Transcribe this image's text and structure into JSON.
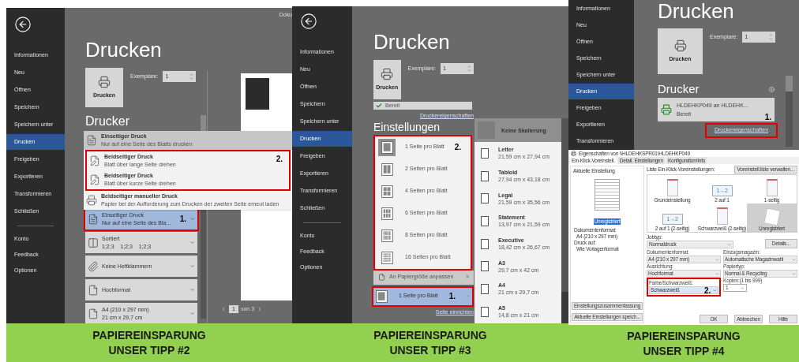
{
  "panels": [
    {
      "kind": "duplex",
      "back_button": true,
      "doc_title": "Doku",
      "sidebar": [
        {
          "label": "Informationen",
          "selected": false
        },
        {
          "label": "Neu",
          "selected": false
        },
        {
          "label": "Öffnen",
          "selected": false
        },
        {
          "label": "Speichern",
          "selected": false
        },
        {
          "label": "Speichern unter",
          "selected": false
        },
        {
          "label": "Drucken",
          "selected": true
        },
        {
          "label": "Freigeben",
          "selected": false
        },
        {
          "label": "Exportieren",
          "selected": false
        },
        {
          "label": "Transformieren",
          "selected": false
        },
        {
          "label": "Schließen",
          "selected": false
        }
      ],
      "sidebar_bottom": [
        "Konto",
        "Feedback",
        "Optionen"
      ],
      "title": "Drucken",
      "print_button": "Drucken",
      "copies_label": "Exemplare:",
      "copies": "1",
      "printer_heading": "Drucker",
      "menu": {
        "before": [
          {
            "title": "Einseitiger Druck",
            "subtitle": "Nur auf eine Seite des Blatts drucken",
            "selected": true
          }
        ],
        "framed": {
          "marker": "2.",
          "items": [
            {
              "title": "Beidseitiger Druck",
              "subtitle": "Blatt über lange Seite drehen",
              "selected": false
            },
            {
              "title": "Beidseitiger Druck",
              "subtitle": "Blatt über kurze Seite drehen",
              "selected": false
            }
          ]
        },
        "after": [
          {
            "title": "Beidseitiger manueller Druck",
            "subtitle": "Papier bei der Aufforderung zum Drucken der zweiten Seite erneut laden",
            "selected": false
          }
        ]
      },
      "settings": [
        {
          "title": "Einseitiger Druck",
          "subtitle": "Nur auf eine Seite des Bla...",
          "selected": true,
          "marker": "1."
        },
        {
          "title": "Sortiert",
          "subtitle": "1;2;3    1;2;3    1;2;3",
          "selected": false
        },
        {
          "title": "Keine Heftklammern",
          "selected": false
        },
        {
          "title": "Hochformat",
          "selected": false
        },
        {
          "title": "A4 (210 x 297 mm)",
          "subtitle": "21 cm x 29,7 cm",
          "selected": false
        }
      ],
      "pager": {
        "page": "1",
        "of": "von 3"
      },
      "footer": [
        "PAPIEREINSPARUNG",
        "UNSER TIPP #2"
      ]
    },
    {
      "kind": "pages",
      "back_button": true,
      "sidebar": [
        {
          "label": "Informationen",
          "selected": false
        },
        {
          "label": "Neu",
          "selected": false
        },
        {
          "label": "Öffnen",
          "selected": false
        },
        {
          "label": "Speichern",
          "selected": false
        },
        {
          "label": "Speichern unter",
          "selected": false
        },
        {
          "label": "Drucken",
          "selected": true
        },
        {
          "label": "Freigeben",
          "selected": false
        },
        {
          "label": "Exportieren",
          "selected": false
        },
        {
          "label": "Transformieren",
          "selected": false
        },
        {
          "label": "Schließen",
          "selected": false
        }
      ],
      "sidebar_bottom": [
        "Konto",
        "Feedback",
        "Optionen"
      ],
      "title": "Drucken",
      "print_button": "Drucken",
      "copies_label": "Exemplare:",
      "copies": "1",
      "printer_status": "Bereit",
      "properties_link": "Druckereigenschaften",
      "settings_heading": "Einstellungen",
      "pages": {
        "marker": "2.",
        "items": [
          {
            "label": "1 Seite pro Blatt",
            "selected": true
          },
          {
            "label": "2 Seiten pro Blatt",
            "selected": false
          },
          {
            "label": "4 Seiten pro Blatt",
            "selected": false
          },
          {
            "label": "6 Seiten pro Blatt",
            "selected": false
          },
          {
            "label": "8 Seiten pro Blatt",
            "selected": false
          },
          {
            "label": "16 Seiten pro Blatt",
            "selected": false
          }
        ]
      },
      "fit_item": "An Papiergröße anpassen",
      "fit_arrow": ">",
      "current": {
        "label": "1 Seite pro Blatt",
        "marker": "1."
      },
      "page_setup_link": "Seite einrichten",
      "scaling": [
        {
          "title": "Keine Skalierung",
          "selected": true
        },
        {
          "title": "Letter",
          "subtitle": "21,59 cm x 27,94 cm",
          "selected": false
        },
        {
          "title": "Tabloid",
          "subtitle": "27,94 cm x 43,18 cm",
          "selected": false
        },
        {
          "title": "Legal",
          "subtitle": "21,59 cm x 35,56 cm",
          "selected": false
        },
        {
          "title": "Statement",
          "subtitle": "13,97 cm x 21,59 cm",
          "selected": false
        },
        {
          "title": "Executive",
          "subtitle": "18,42 cm x 26,67 cm",
          "selected": false
        },
        {
          "title": "A3",
          "subtitle": "29,7 cm x 42 cm",
          "selected": false
        },
        {
          "title": "A4",
          "subtitle": "21 cm x 29,7 cm",
          "selected": false
        },
        {
          "title": "A5",
          "subtitle": "14,8 cm x 21 cm",
          "selected": false
        }
      ],
      "footer": [
        "PAPIEREINSPARUNG",
        "UNSER TIPP #3"
      ]
    },
    {
      "kind": "printer",
      "sidebar": [
        {
          "label": "Informationen",
          "selected": false
        },
        {
          "label": "Neu",
          "selected": false
        },
        {
          "label": "Öffnen",
          "selected": false
        },
        {
          "label": "Speichern",
          "selected": false
        },
        {
          "label": "Speichern unter",
          "selected": false
        },
        {
          "label": "Drucken",
          "selected": true
        },
        {
          "label": "Freigeben",
          "selected": false
        },
        {
          "label": "Exportieren",
          "selected": false
        },
        {
          "label": "Transformieren",
          "selected": false
        }
      ],
      "title": "Drucken",
      "print_button": "Drucken",
      "copies_label": "Exemplare:",
      "copies": "1",
      "printer_heading": "Drucker",
      "printer": {
        "name": "HLDEHKP049 an HLDEHK...",
        "status": "Bereit",
        "marker": "1."
      },
      "properties_link": "Druckereigenschaften",
      "dialog": {
        "title": "Eigenschaften von \\\\HLDEHKSPR01\\HLDEHKP049",
        "tabs": [
          {
            "label": "Ein-Klick-Voreinstell.",
            "selected": true
          },
          {
            "label": "Detail. Einstellungen",
            "selected": false
          },
          {
            "label": "Konfiguration/Info",
            "selected": false
          }
        ],
        "current_label": "Aktuelle Einstellung",
        "current_name": "Unregistriert",
        "summary": [
          "Dokumentenformat:",
          "A4 (210 x 297 mm)",
          "Druck auf:",
          "Wie Vorlagenformat"
        ],
        "left_buttons": [
          "Einstellungszusammenfassung",
          "Aktuelle Einstellungen speich..."
        ],
        "list_label": "Liste Ein-Klick-Voreinstellungen:",
        "manage_button": "Voreinstell.liste verwalten...",
        "presets": [
          {
            "label": "Grundeinstellung",
            "selected": false
          },
          {
            "label": "2 auf 1",
            "icon_text": "1→2",
            "selected": false
          },
          {
            "label": "1-seitig",
            "selected": false
          },
          {
            "label": "2 auf 1 (2-seitig)",
            "icon_text": "1→2",
            "selected": false
          },
          {
            "label": "Schwarzweiß (2-seitig)",
            "selected": false
          },
          {
            "label": "Unregistriert",
            "selected": true
          }
        ],
        "job": {
          "label": "Jobtyp:",
          "value": "Normaldruck",
          "button": "Details..."
        },
        "fields": [
          {
            "label": "Dokumentenformat:",
            "value": "A4 (210 x 297 mm)",
            "kind": "select"
          },
          {
            "label": "Einzugsmagazin:",
            "value": "Automatische Magazinwahl",
            "kind": "select"
          },
          {
            "label": "Ausrichtung:",
            "value": "Hochformat",
            "kind": "select"
          },
          {
            "label": "Papiertyp:",
            "value": "Normal & Recycling",
            "kind": "select"
          },
          {
            "label": "Farbe/Schwarzweiß:",
            "value": "Schwarzweiß",
            "kind": "select",
            "marker": "2."
          },
          {
            "label": "Kopien:(1 bis 999)",
            "value": "1",
            "kind": "spin"
          }
        ],
        "buttons": [
          "OK",
          "Abbrechen",
          "Hilfe"
        ]
      },
      "footer": [
        "PAPIEREINSPARUNG",
        "UNSER TIPP #4"
      ]
    }
  ]
}
